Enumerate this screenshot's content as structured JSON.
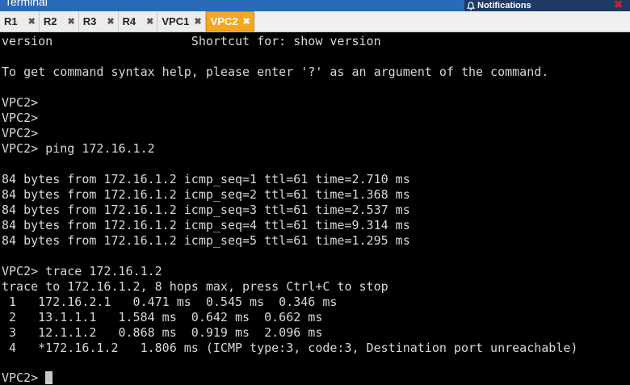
{
  "window": {
    "title": "Terminal"
  },
  "notifications": {
    "label": "Notifications",
    "close": "✖"
  },
  "tabs": [
    {
      "label": "R1",
      "close": "✖",
      "active": false
    },
    {
      "label": "R2",
      "close": "✖",
      "active": false
    },
    {
      "label": "R3",
      "close": "✖",
      "active": false
    },
    {
      "label": "R4",
      "close": "✖",
      "active": false
    },
    {
      "label": "VPC1",
      "close": "✖",
      "active": false
    },
    {
      "label": "VPC2",
      "close": "✖",
      "active": true
    }
  ],
  "terminal": {
    "lines": [
      "version                   Shortcut for: show version",
      "",
      "To get command syntax help, please enter '?' as an argument of the command.",
      "",
      "VPC2>",
      "VPC2>",
      "VPC2>",
      "VPC2> ping 172.16.1.2",
      "",
      "84 bytes from 172.16.1.2 icmp_seq=1 ttl=61 time=2.710 ms",
      "84 bytes from 172.16.1.2 icmp_seq=2 ttl=61 time=1.368 ms",
      "84 bytes from 172.16.1.2 icmp_seq=3 ttl=61 time=2.537 ms",
      "84 bytes from 172.16.1.2 icmp_seq=4 ttl=61 time=9.314 ms",
      "84 bytes from 172.16.1.2 icmp_seq=5 ttl=61 time=1.295 ms",
      "",
      "VPC2> trace 172.16.1.2",
      "trace to 172.16.1.2, 8 hops max, press Ctrl+C to stop",
      " 1   172.16.2.1   0.471 ms  0.545 ms  0.346 ms",
      " 2   13.1.1.1   1.584 ms  0.642 ms  0.662 ms",
      " 3   12.1.1.2   0.868 ms  0.919 ms  2.096 ms",
      " 4   *172.16.1.2   1.806 ms (ICMP type:3, code:3, Destination port unreachable)",
      ""
    ],
    "prompt": "VPC2> "
  },
  "colors": {
    "terminal_bg": "#000000",
    "terminal_fg": "#d8d8d8",
    "active_tab": "#f5a623",
    "titlebar": "#2a6ab8",
    "notif_close": "#d42020"
  }
}
